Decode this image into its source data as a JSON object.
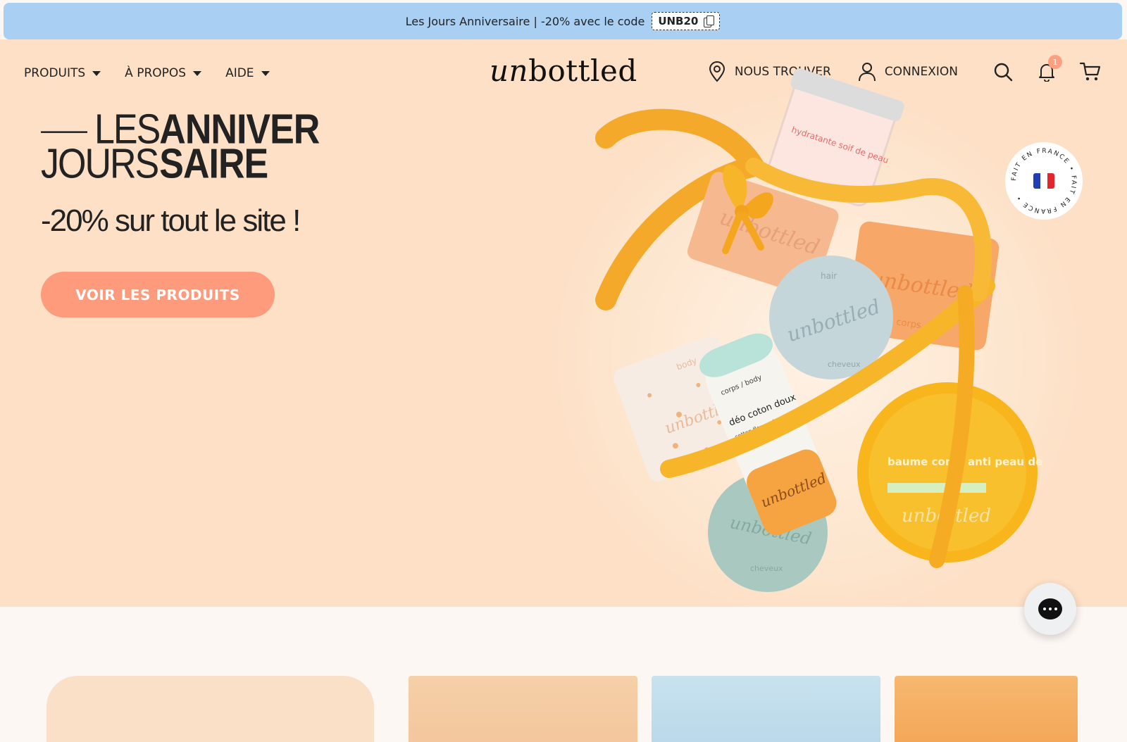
{
  "announcement": {
    "text": "Les Jours Anniversaire | -20% avec le code",
    "code": "UNB20"
  },
  "nav": {
    "left": [
      {
        "label": "PRODUITS"
      },
      {
        "label": "À PROPOS"
      },
      {
        "label": "AIDE"
      }
    ],
    "logo": {
      "script": "un",
      "rest": "bottled"
    },
    "find_label": "NOUS TROUVER",
    "login_label": "CONNEXION",
    "notification_count": "1"
  },
  "hero": {
    "headline": {
      "line1_light": "LES",
      "line1_bold": "ANNIVER",
      "line2_light": "JOURS",
      "line2_bold": "SAIRE"
    },
    "subheadline": "-20% sur tout le site !",
    "cta_label": "VOIR LES PRODUITS",
    "badge_text": "FAIT EN FRANCE • FAIT EN FRANCE •",
    "product_labels": {
      "jar": "hydratante soif de peau",
      "bar_center": "unbottled",
      "bar_center_top": "hair",
      "bar_center_bottom": "cheveux",
      "bar_right": "unbottled",
      "bar_right_bottom": "corps",
      "deo_top": "corps / body",
      "deo_title": "déo coton doux",
      "deo_sub": "cotton flower deodorant",
      "deo_brand": "unbottled",
      "tin_title": "baume corps anti peau de croco",
      "tin_brand": "unbottled",
      "shampoo_brand": "unbottled",
      "shampoo_bottom": "cheveux",
      "soap_top": "body",
      "soap_brand": "unbottled",
      "left_bar_brand": "unbottled"
    }
  },
  "colors": {
    "announcement_bg": "#a9cff2",
    "hero_bg": "#fde0c6",
    "cta_bg": "#ff9b7d",
    "ribbon": "#f7b52a",
    "badge": "#ff9f7f"
  },
  "icons": [
    "copy-icon",
    "location-pin-icon",
    "user-icon",
    "search-icon",
    "bell-icon",
    "cart-icon",
    "chat-icon",
    "flag-france-icon"
  ]
}
